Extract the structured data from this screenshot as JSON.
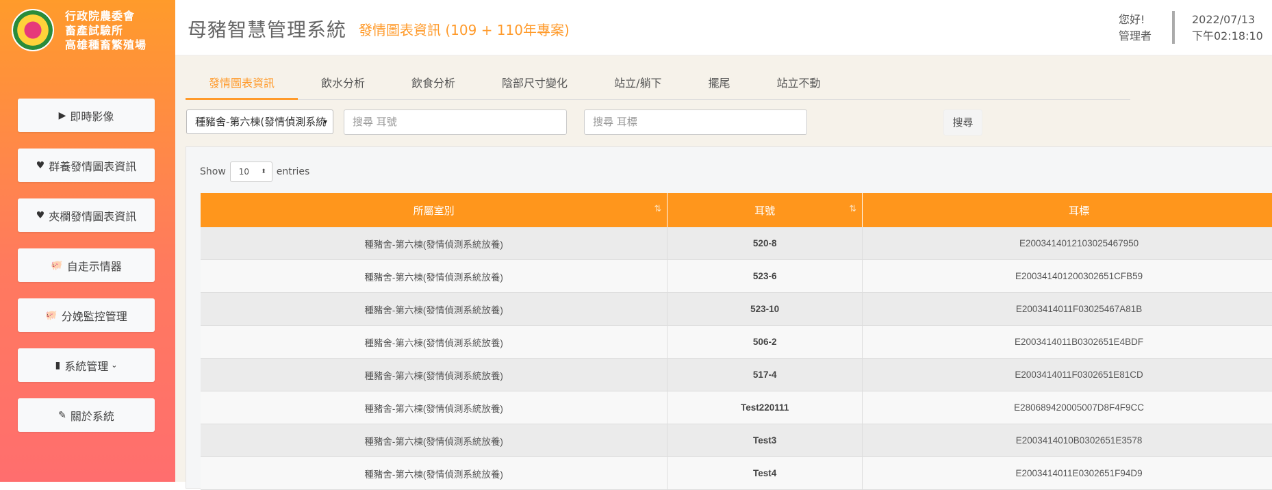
{
  "org": {
    "name_lines": [
      "行政院農委會",
      "畜產試驗所",
      "高雄種畜繁殖場"
    ]
  },
  "sidebar": {
    "items": [
      {
        "label": "即時影像",
        "icon": "play-square-icon"
      },
      {
        "label": "群養發情圖表資訊",
        "icon": "heart-icon"
      },
      {
        "label": "夾欄發情圖表資訊",
        "icon": "heart-icon"
      },
      {
        "label": "自走示情器",
        "icon": "piggy-icon"
      },
      {
        "label": "分娩監控管理",
        "icon": "piggy-icon"
      },
      {
        "label": "系統管理",
        "icon": "book-icon"
      },
      {
        "label": "關於系統",
        "icon": "edit-icon"
      }
    ]
  },
  "header": {
    "title": "母豬智慧管理系統",
    "subtitle": "發情圖表資訊 (109 + 110年專案)",
    "greeting": "您好!",
    "role": "管理者",
    "date": "2022/07/13",
    "time": "下午02:18:10"
  },
  "tabs": [
    {
      "label": "發情圖表資訊",
      "active": true
    },
    {
      "label": "飲水分析",
      "active": false
    },
    {
      "label": "飲食分析",
      "active": false
    },
    {
      "label": "陰部尺寸變化",
      "active": false
    },
    {
      "label": "站立/躺下",
      "active": false
    },
    {
      "label": "擺尾",
      "active": false
    },
    {
      "label": "站立不動",
      "active": false
    }
  ],
  "filters": {
    "barn_selected": "種豬舍-第六棟(發情偵測系統",
    "ear_no_placeholder": "搜尋 耳號",
    "ear_tag_placeholder": "搜尋 耳標",
    "search_label": "搜尋"
  },
  "table": {
    "length_prefix": "Show",
    "length_value": "10",
    "length_suffix": "entries",
    "columns": [
      "所屬室別",
      "耳號",
      "耳標"
    ],
    "rows": [
      {
        "room": "種豬舍-第六棟(發情偵測系統放養)",
        "ear_no": "520-8",
        "ear_tag": "E2003414012103025467950"
      },
      {
        "room": "種豬舍-第六棟(發情偵測系統放養)",
        "ear_no": "523-6",
        "ear_tag": "E200341401200302651CFB59"
      },
      {
        "room": "種豬舍-第六棟(發情偵測系統放養)",
        "ear_no": "523-10",
        "ear_tag": "E2003414011F03025467A81B"
      },
      {
        "room": "種豬舍-第六棟(發情偵測系統放養)",
        "ear_no": "506-2",
        "ear_tag": "E2003414011B0302651E4BDF"
      },
      {
        "room": "種豬舍-第六棟(發情偵測系統放養)",
        "ear_no": "517-4",
        "ear_tag": "E2003414011F0302651E81CD"
      },
      {
        "room": "種豬舍-第六棟(發情偵測系統放養)",
        "ear_no": "Test220111",
        "ear_tag": "E280689420005007D8F4F9CC"
      },
      {
        "room": "種豬舍-第六棟(發情偵測系統放養)",
        "ear_no": "Test3",
        "ear_tag": "E2003414010B0302651E3578"
      },
      {
        "room": "種豬舍-第六棟(發情偵測系統放養)",
        "ear_no": "Test4",
        "ear_tag": "E2003414011E0302651F94D9"
      }
    ]
  },
  "colors": {
    "accent": "#ff961c",
    "sidebar_top": "#ff9b2b",
    "sidebar_bottom": "#ff6e6e"
  }
}
